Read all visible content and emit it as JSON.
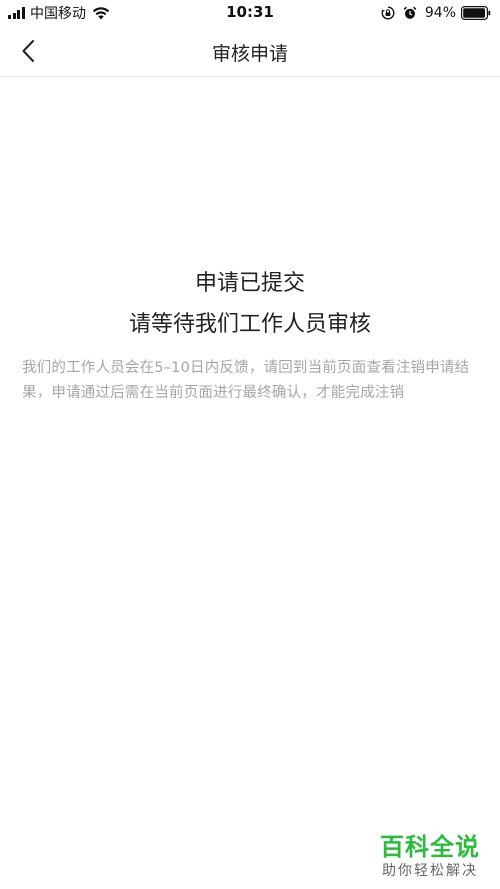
{
  "status_bar": {
    "carrier": "中国移动",
    "time": "10:31",
    "battery": "94%",
    "icons": [
      "signal-icon",
      "wifi-icon",
      "rotation-lock-icon",
      "alarm-icon",
      "battery-icon"
    ]
  },
  "nav": {
    "title": "审核申请",
    "back_icon": "chevron-left-icon"
  },
  "main": {
    "headline_1": "申请已提交",
    "headline_2": "请等待我们工作人员审核",
    "description": "我们的工作人员会在5–10日内反馈，请回到当前页面查看注销申请结果，申请通过后需在当前页面进行最终确认，才能完成注销"
  },
  "watermark": {
    "title": "百科全说",
    "subtitle": "助你轻松解决"
  },
  "colors": {
    "text": "#222222",
    "muted_text": "#a6a6a6",
    "watermark_green": "#2cbb3c",
    "divider": "#ececec"
  }
}
